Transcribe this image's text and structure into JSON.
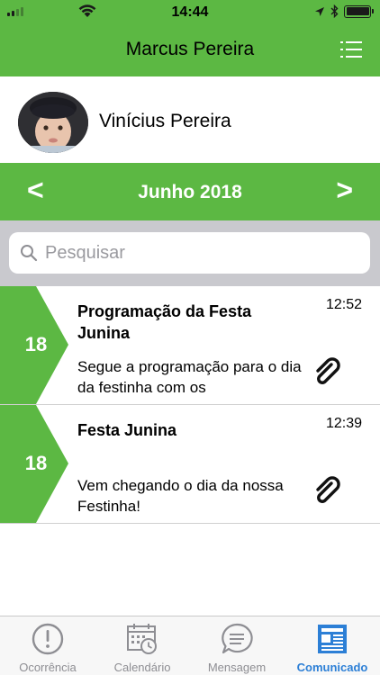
{
  "status_bar": {
    "time": "14:44"
  },
  "header": {
    "title": "Marcus Pereira",
    "menu_icon": "list-icon"
  },
  "profile": {
    "name": "Vinícius Pereira"
  },
  "month_nav": {
    "prev": "<",
    "label": "Junho 2018",
    "next": ">"
  },
  "search": {
    "placeholder": "Pesquisar",
    "value": ""
  },
  "messages": [
    {
      "day": "18",
      "title": "Programação da Festa Junina",
      "time": "12:52",
      "preview": "Segue a programação para o dia da festinha com os",
      "attachment_icon": "paperclip-icon"
    },
    {
      "day": "18",
      "title": "Festa Junina",
      "time": "12:39",
      "preview": "Vem chegando o dia da nossa Festinha!",
      "attachment_icon": "paperclip-icon"
    }
  ],
  "tabs": [
    {
      "label": "Ocorrência",
      "icon": "alert-circle-icon",
      "active": false
    },
    {
      "label": "Calendário",
      "icon": "calendar-clock-icon",
      "active": false
    },
    {
      "label": "Mensagem",
      "icon": "chat-icon",
      "active": false
    },
    {
      "label": "Comunicado",
      "icon": "newspaper-icon",
      "active": true
    }
  ],
  "colors": {
    "brand_green": "#5cb843",
    "active_blue": "#2c7fd6",
    "inactive_gray": "#8e8e93"
  }
}
